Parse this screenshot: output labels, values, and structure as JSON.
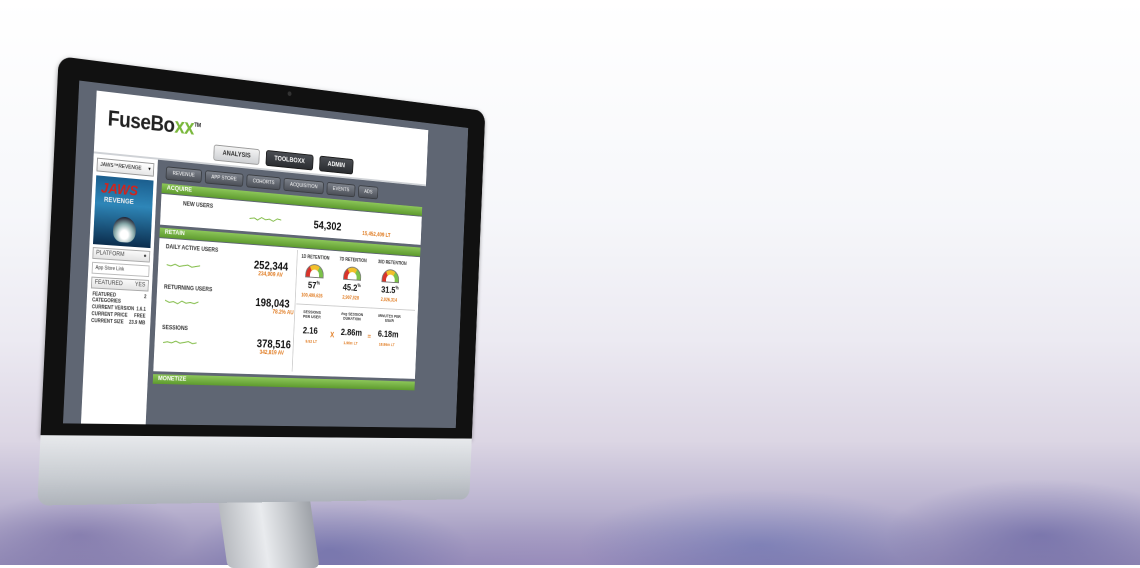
{
  "app": {
    "logo_main": "FuseBo",
    "logo_accent": "xx",
    "logo_tm": "TM"
  },
  "main_nav": [
    {
      "label": "ANALYSIS",
      "active": true
    },
    {
      "label": "TOOLBOXX",
      "active": false
    },
    {
      "label": "ADMIN",
      "active": false
    }
  ],
  "sidebar": {
    "app_select": "JAWS™REVENGE",
    "select_caret": "▾",
    "poster_title": "JAWS",
    "poster_subtitle": "REVENGE",
    "platform_label": "PLATFORM",
    "platform_icon": "apple-icon",
    "app_store_link": "App Store Link",
    "featured_label": "FEATURED",
    "featured_value": "YES",
    "details": [
      {
        "label": "FEATURED CATEGORIES",
        "value": "2"
      },
      {
        "label": "CURRENT VERSION",
        "value": "1.6.1"
      },
      {
        "label": "CURRENT PRICE",
        "value": "FREE"
      },
      {
        "label": "CURRENT SIZE",
        "value": "23.9 MB"
      }
    ]
  },
  "sub_nav": [
    "REVENUE",
    "APP STORE",
    "COHORTS",
    "ACQUISITION",
    "EVENTS",
    "ADS"
  ],
  "acquire": {
    "section": "ACQUIRE",
    "label": "NEW USERS",
    "value": "54,302",
    "lifetime": "15,452,409 LT"
  },
  "retain": {
    "section": "RETAIN",
    "metrics": [
      {
        "label": "DAILY ACTIVE USERS",
        "value": "252,344",
        "sub": "234,909 AV"
      },
      {
        "label": "RETURNING USERS",
        "value": "198,043",
        "sub": "78.2% AU"
      },
      {
        "label": "SESSIONS",
        "value": "378,516",
        "sub": "342,819 AV"
      }
    ],
    "retention": [
      {
        "label": "1D RETENTION",
        "value": "57",
        "unit": "%",
        "sub": "100,499,626"
      },
      {
        "label": "7D RETENTION",
        "value": "45.2",
        "unit": "%",
        "sub": "2,907,928"
      },
      {
        "label": "30D RETENTION",
        "value": "31.5",
        "unit": "%",
        "sub": "2,026,314"
      }
    ],
    "formula": [
      {
        "label": "SESSIONS PER USER",
        "value": "2.16",
        "sub": "9.52 LT"
      },
      {
        "label": "Avg SESSION DURATION",
        "value": "2.86m",
        "sub": "1.96m LT"
      },
      {
        "label": "MINUTES PER USER",
        "value": "6.18m",
        "sub": "18.86m LT"
      }
    ],
    "op_multiply": "X",
    "op_equals": "="
  },
  "monetize": {
    "section": "MONETIZE"
  }
}
